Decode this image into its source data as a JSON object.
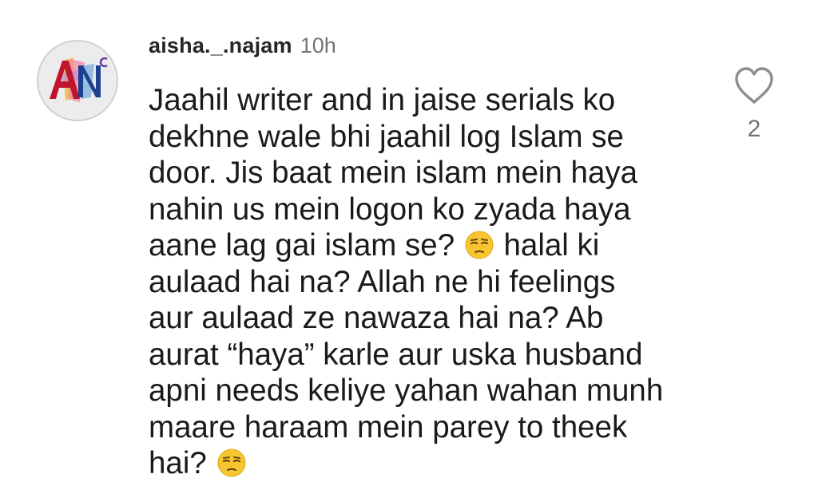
{
  "comment": {
    "username": "aisha._.najam",
    "timestamp": "10h",
    "avatar_icon": "profile-avatar-logo",
    "lines": [
      {
        "parts": [
          {
            "text": "Jaahil writer and in jaise serials ko"
          }
        ]
      },
      {
        "parts": [
          {
            "text": "dekhne wale bhi jaahil log Islam se"
          }
        ]
      },
      {
        "parts": [
          {
            "text": "door. Jis baat mein islam mein haya"
          }
        ]
      },
      {
        "parts": [
          {
            "text": "nahin us mein logon ko zyada haya"
          }
        ]
      },
      {
        "parts": [
          {
            "text": "aane lag gai islam se? "
          },
          {
            "emoji": "unamused-face"
          },
          {
            "text": " halal ki"
          }
        ]
      },
      {
        "parts": [
          {
            "text": "aulaad hai na? Allah ne hi feelings"
          }
        ]
      },
      {
        "parts": [
          {
            "text": "aur aulaad ze nawaza hai na? Ab"
          }
        ]
      },
      {
        "parts": [
          {
            "text": "aurat “haya” karle aur uska husband"
          }
        ]
      },
      {
        "parts": [
          {
            "text": "apni needs keliye yahan wahan munh"
          }
        ]
      },
      {
        "parts": [
          {
            "text": "maare haraam mein parey to theek"
          }
        ]
      },
      {
        "parts": [
          {
            "text": "hai? "
          },
          {
            "emoji": "unamused-face"
          }
        ]
      }
    ],
    "like_icon": "heart-outline-icon",
    "like_count": "2"
  }
}
